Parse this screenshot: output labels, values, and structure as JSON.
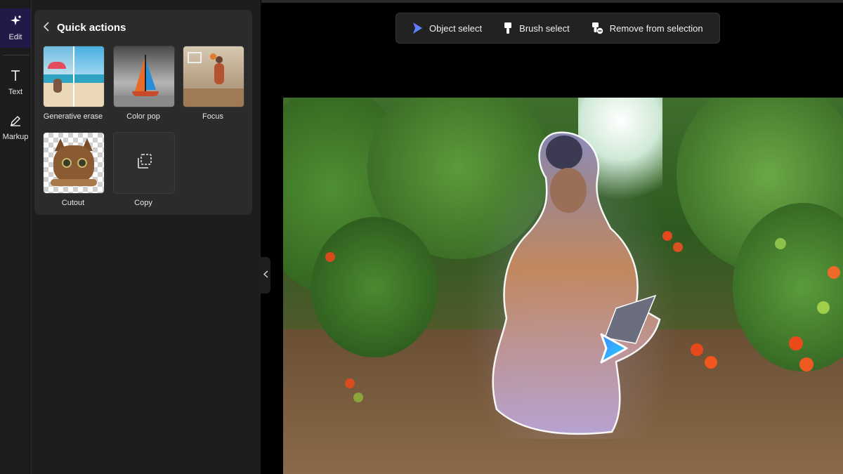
{
  "rail": {
    "items": [
      {
        "label": "Edit",
        "icon": "sparkle-icon",
        "active": true
      },
      {
        "label": "Text",
        "icon": "text-icon",
        "active": false
      },
      {
        "label": "Markup",
        "icon": "pen-icon",
        "active": false
      }
    ]
  },
  "quick_actions": {
    "title": "Quick actions",
    "back_icon": "chevron-left-icon",
    "tiles": [
      {
        "label": "Generative erase"
      },
      {
        "label": "Color pop"
      },
      {
        "label": "Focus"
      },
      {
        "label": "Cutout"
      },
      {
        "label": "Copy"
      }
    ]
  },
  "collapse_icon": "chevron-left-icon",
  "toolbar": {
    "object_select": "Object select",
    "brush_select": "Brush select",
    "remove_selection": "Remove from selection"
  },
  "colors": {
    "accent": "#4b6bff",
    "rail_active": "#1f1a48",
    "panel_bg": "#2b2b2b",
    "selection_glow": "#b8a8ff"
  }
}
